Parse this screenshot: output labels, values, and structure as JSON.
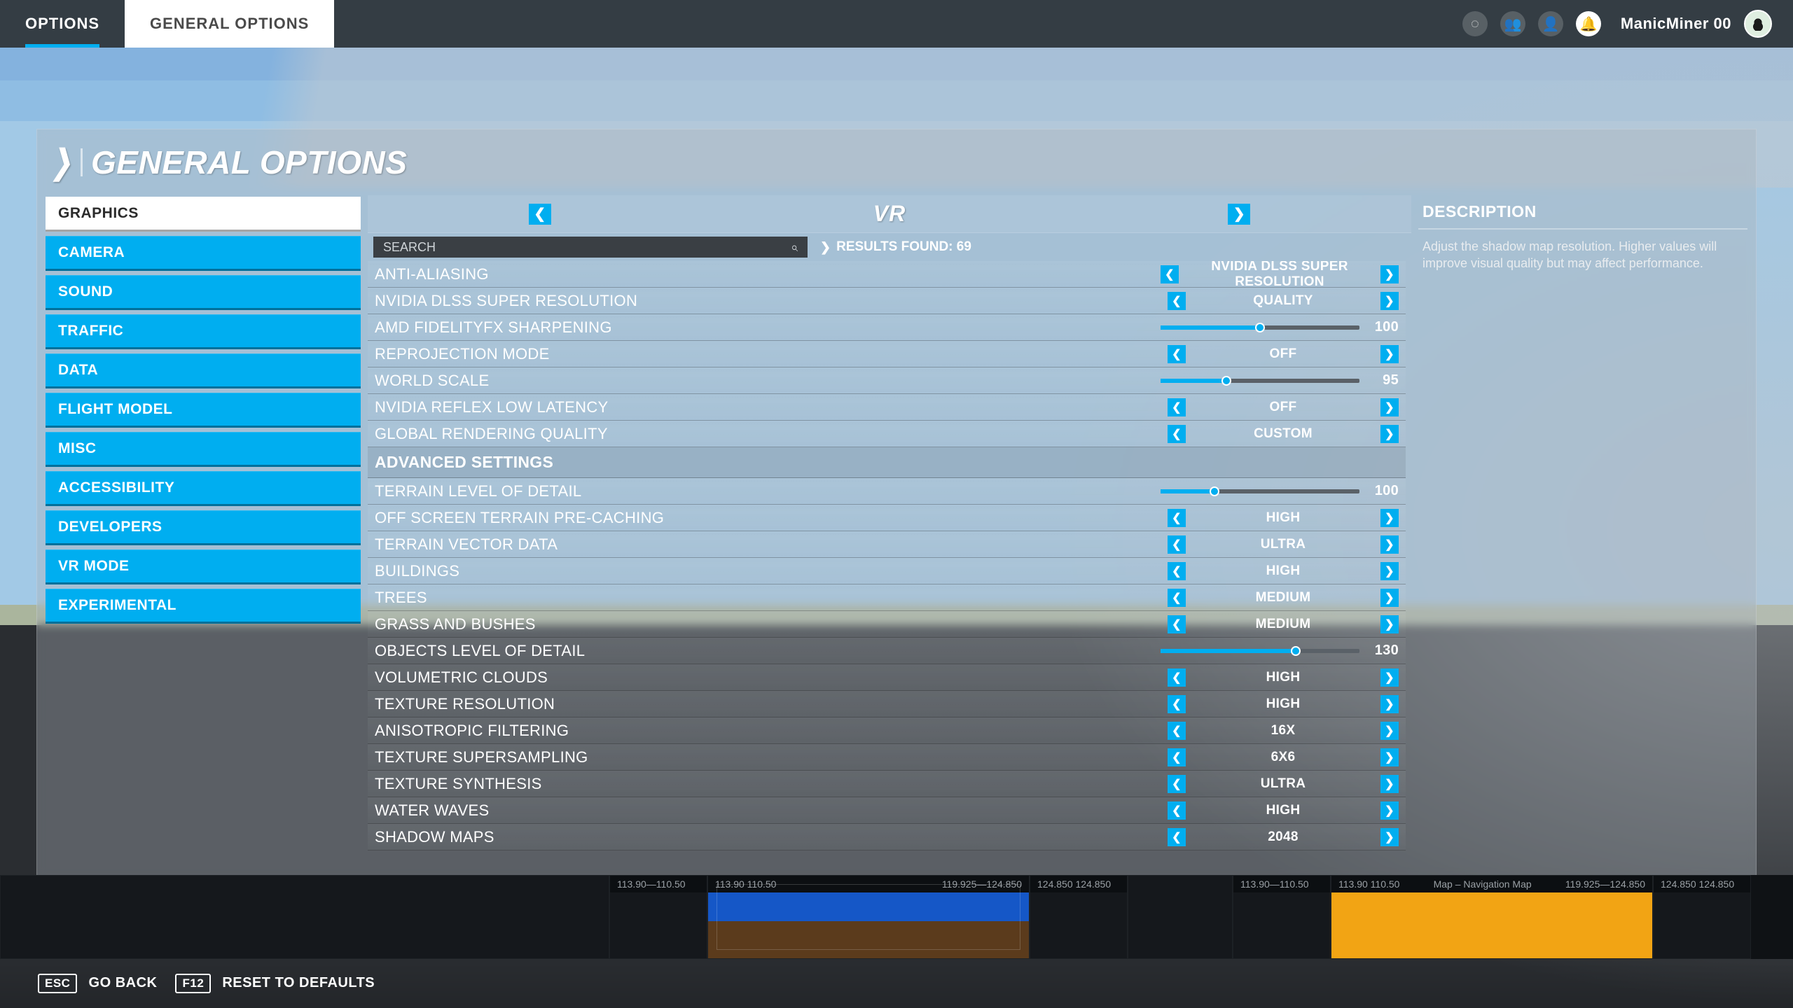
{
  "topbar": {
    "root_tab": "OPTIONS",
    "current_tab": "GENERAL OPTIONS",
    "username": "ManicMiner 00"
  },
  "panel_title": "GENERAL OPTIONS",
  "sidebar": {
    "items": [
      {
        "label": "GRAPHICS",
        "selected": true
      },
      {
        "label": "CAMERA"
      },
      {
        "label": "SOUND"
      },
      {
        "label": "TRAFFIC"
      },
      {
        "label": "DATA"
      },
      {
        "label": "FLIGHT MODEL"
      },
      {
        "label": "MISC"
      },
      {
        "label": "ACCESSIBILITY"
      },
      {
        "label": "DEVELOPERS"
      },
      {
        "label": "VR MODE"
      },
      {
        "label": "EXPERIMENTAL"
      }
    ]
  },
  "mid_header": {
    "title": "VR"
  },
  "search": {
    "placeholder": "SEARCH",
    "results_label": "RESULTS FOUND: 69"
  },
  "settings": [
    {
      "kind": "select",
      "label": "ANTI-ALIASING",
      "value": "NVIDIA DLSS SUPER RESOLUTION",
      "wide": true
    },
    {
      "kind": "select",
      "label": "NVIDIA DLSS SUPER RESOLUTION",
      "value": "QUALITY"
    },
    {
      "kind": "slider",
      "label": "AMD FIDELITYFX SHARPENING",
      "value": 100,
      "pct": 50
    },
    {
      "kind": "select",
      "label": "REPROJECTION MODE",
      "value": "OFF"
    },
    {
      "kind": "slider",
      "label": "WORLD SCALE",
      "value": 95,
      "pct": 33
    },
    {
      "kind": "select",
      "label": "NVIDIA REFLEX LOW LATENCY",
      "value": "OFF"
    },
    {
      "kind": "select",
      "label": "GLOBAL RENDERING QUALITY",
      "value": "CUSTOM"
    },
    {
      "kind": "section",
      "label": "ADVANCED SETTINGS"
    },
    {
      "kind": "slider",
      "label": "TERRAIN LEVEL OF DETAIL",
      "value": 100,
      "pct": 27
    },
    {
      "kind": "select",
      "label": "OFF SCREEN TERRAIN PRE-CACHING",
      "value": "HIGH"
    },
    {
      "kind": "select",
      "label": "TERRAIN VECTOR DATA",
      "value": "ULTRA"
    },
    {
      "kind": "select",
      "label": "BUILDINGS",
      "value": "HIGH"
    },
    {
      "kind": "select",
      "label": "TREES",
      "value": "MEDIUM"
    },
    {
      "kind": "select",
      "label": "GRASS AND BUSHES",
      "value": "MEDIUM"
    },
    {
      "kind": "slider",
      "label": "OBJECTS LEVEL OF DETAIL",
      "value": 130,
      "pct": 68
    },
    {
      "kind": "select",
      "label": "VOLUMETRIC CLOUDS",
      "value": "HIGH"
    },
    {
      "kind": "select",
      "label": "TEXTURE RESOLUTION",
      "value": "HIGH"
    },
    {
      "kind": "select",
      "label": "ANISOTROPIC FILTERING",
      "value": "16X"
    },
    {
      "kind": "select",
      "label": "TEXTURE SUPERSAMPLING",
      "value": "6X6"
    },
    {
      "kind": "select",
      "label": "TEXTURE SYNTHESIS",
      "value": "ULTRA"
    },
    {
      "kind": "select",
      "label": "WATER WAVES",
      "value": "HIGH"
    },
    {
      "kind": "select",
      "label": "SHADOW MAPS",
      "value": "2048"
    }
  ],
  "description": {
    "title": "DESCRIPTION",
    "body": "Adjust the shadow map resolution.\nHigher values will improve visual quality but may affect performance."
  },
  "instruments": {
    "left_freq": "113.90—110.50",
    "left_freq2": "113.90  110.50",
    "right_freq": "119.925—124.850",
    "right_freq2": "124.850  124.850",
    "nav_title": "Map – Navigation Map"
  },
  "footer": {
    "back_key": "ESC",
    "back_label": "GO BACK",
    "reset_key": "F12",
    "reset_label": "RESET TO DEFAULTS"
  },
  "glyph": {
    "left": "❮",
    "right": "❯",
    "search": "⌕",
    "globe": "◌",
    "group": "👥",
    "user": "👤",
    "bell": "🔔"
  }
}
